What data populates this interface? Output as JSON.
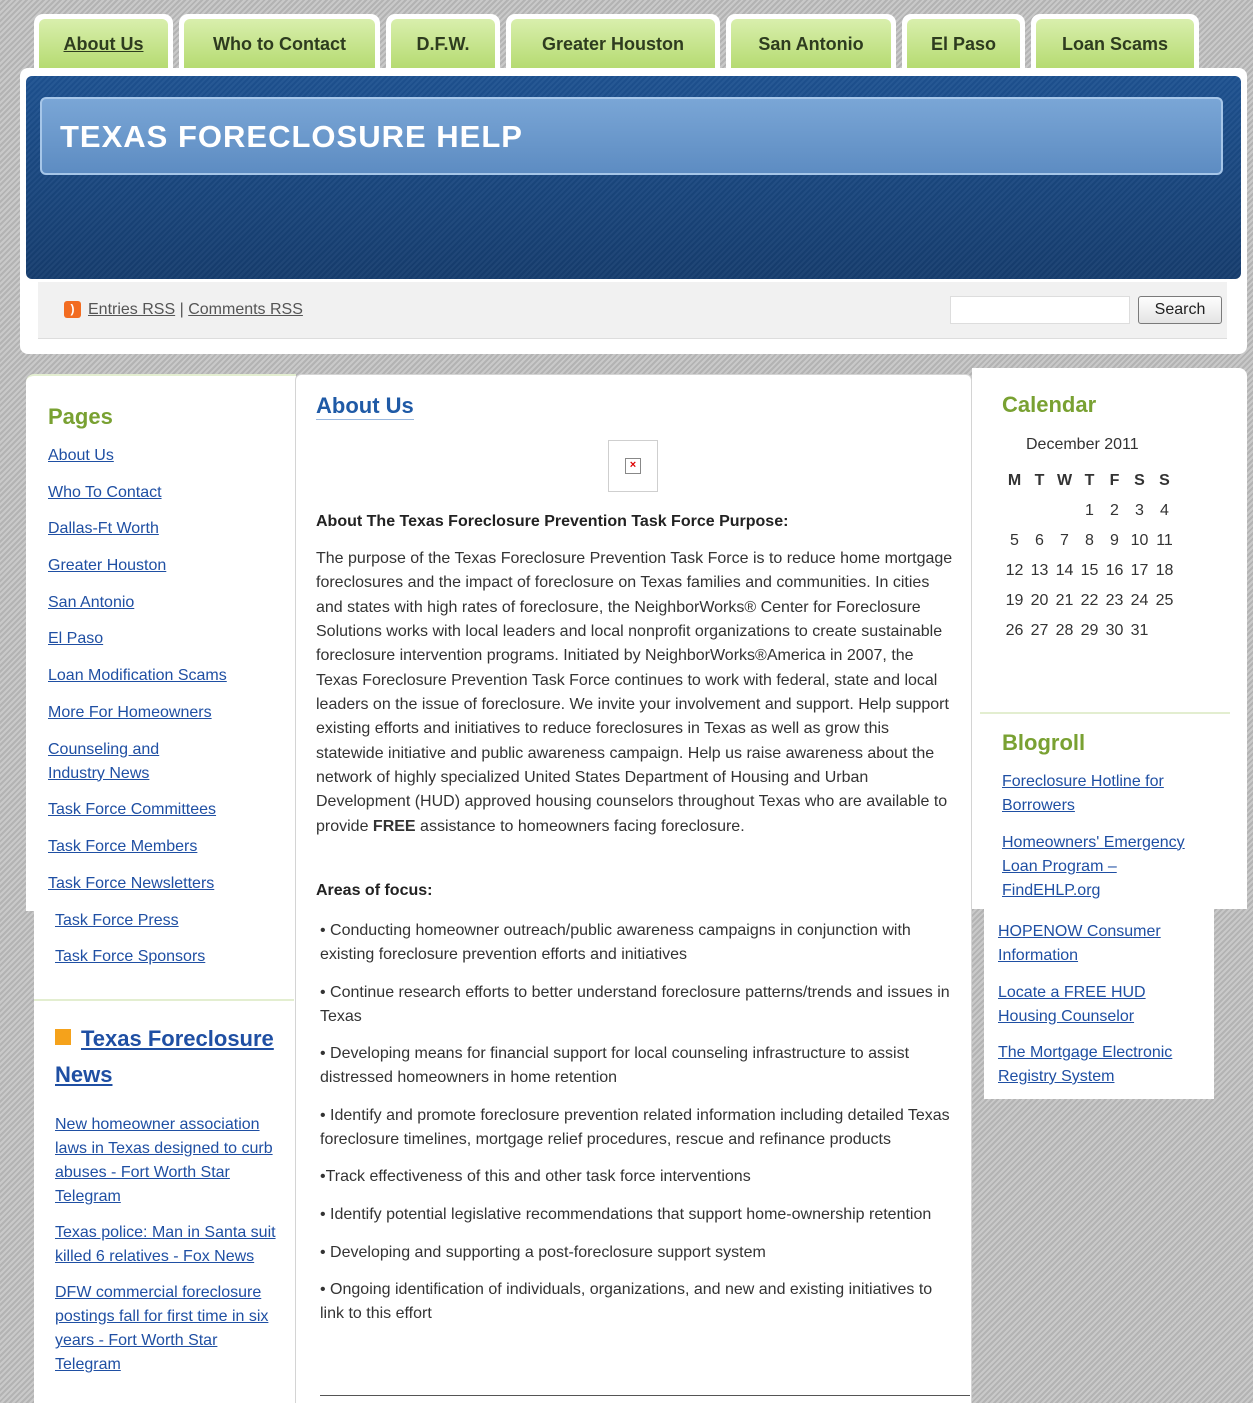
{
  "nav": {
    "tabs": [
      {
        "label": "About Us",
        "active": true
      },
      {
        "label": "Who to Contact"
      },
      {
        "label": "D.F.W."
      },
      {
        "label": "Greater Houston"
      },
      {
        "label": "San Antonio"
      },
      {
        "label": "El Paso"
      },
      {
        "label": "Loan Scams"
      }
    ]
  },
  "header": {
    "site_title": "TEXAS FORECLOSURE HELP",
    "rss_icon": "rss-icon",
    "entries_rss": "Entries RSS",
    "separator": "|",
    "comments_rss": "Comments RSS",
    "search_placeholder": "",
    "search_button": "Search"
  },
  "sidebar_left": {
    "pages_title": "Pages",
    "pages": [
      "About Us",
      "Who To Contact",
      "Dallas-Ft Worth",
      "Greater Houston",
      "San Antonio",
      "El Paso",
      "Loan Modification Scams",
      "More For Homeowners",
      "Counseling and Industry News",
      "Task Force Committees",
      "Task Force Members",
      "Task Force Newsletters",
      "Task Force Press",
      "Task Force Sponsors"
    ],
    "news_title": "Texas Foreclosure News",
    "news_items": [
      "New homeowner association laws in Texas designed to curb abuses - Fort Worth Star Telegram",
      "Texas police: Man in Santa suit killed 6 relatives - Fox News",
      "DFW commercial foreclosure postings fall for first time in six years - Fort Worth Star Telegram"
    ]
  },
  "main": {
    "title": "About Us",
    "image_icon": "broken-image-icon",
    "purpose_heading": "About The Texas Foreclosure Prevention Task Force Purpose:",
    "purpose_text": "The purpose of the Texas Foreclosure Prevention Task Force is to reduce home mortgage foreclosures and the impact of foreclosure on Texas families and communities. In cities and states with high rates of foreclosure, the NeighborWorks® Center for Foreclosure Solutions works with local leaders and local nonprofit organizations to create sustainable foreclosure intervention programs. Initiated by NeighborWorks®America in 2007, the Texas Foreclosure Prevention Task Force continues to work with federal, state and local leaders on the issue of foreclosure. We invite your involvement and support. Help support existing efforts and initiatives to reduce foreclosures in Texas as well as grow this statewide initiative and public awareness campaign. Help us raise awareness about the network of highly specialized United States Department of Housing and Urban Development (HUD) approved housing counselors throughout Texas who are available to provide ",
    "purpose_free": "FREE",
    "purpose_tail": " assistance to homeowners facing foreclosure.",
    "focus_heading": "Areas of focus:",
    "focus_items": [
      "• Conducting homeowner outreach/public awareness campaigns in conjunction with existing foreclosure prevention efforts and initiatives",
      "• Continue research efforts to better understand foreclosure patterns/trends and issues in Texas",
      "• Developing means for financial support for local counseling infrastructure to assist distressed homeowners in home retention",
      "• Identify and promote foreclosure prevention related information including detailed Texas foreclosure timelines, mortgage relief procedures, rescue and refinance products",
      "•Track effectiveness of this and other task force interventions",
      "• Identify potential legislative recommendations that support home-ownership retention",
      "• Developing and supporting a post-foreclosure support system",
      "• Ongoing identification of individuals, organizations, and new and existing initiatives to link to this effort"
    ]
  },
  "sidebar_right": {
    "calendar_title": "Calendar",
    "calendar_caption": "December 2011",
    "weekdays": [
      "M",
      "T",
      "W",
      "T",
      "F",
      "S",
      "S"
    ],
    "weeks": [
      [
        "",
        "",
        "",
        "1",
        "2",
        "3",
        "4"
      ],
      [
        "5",
        "6",
        "7",
        "8",
        "9",
        "10",
        "11"
      ],
      [
        "12",
        "13",
        "14",
        "15",
        "16",
        "17",
        "18"
      ],
      [
        "19",
        "20",
        "21",
        "22",
        "23",
        "24",
        "25"
      ],
      [
        "26",
        "27",
        "28",
        "29",
        "30",
        "31",
        ""
      ]
    ],
    "blogroll_title": "Blogroll",
    "blogroll": [
      "Foreclosure Hotline for Borrowers",
      "Homeowners' Emergency Loan Program – FindEHLP.org",
      "HOPENOW Consumer Information",
      "Locate a FREE HUD Housing Counselor",
      "The Mortgage Electronic Registry System"
    ]
  }
}
